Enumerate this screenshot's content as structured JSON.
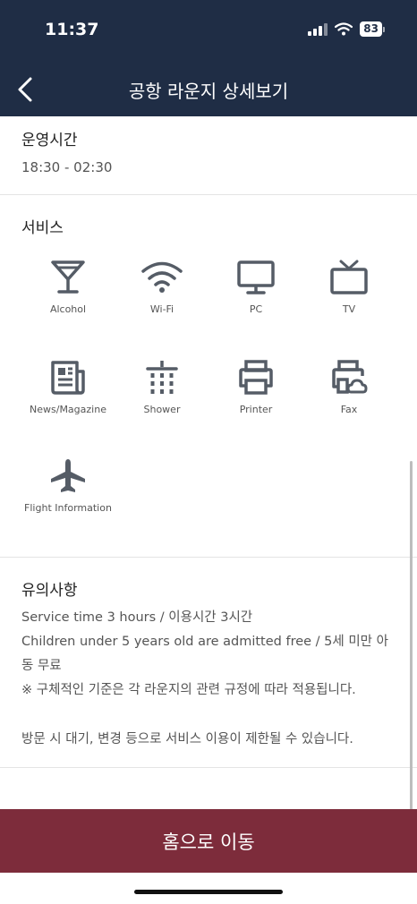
{
  "status_bar": {
    "time": "11:37",
    "battery": "83"
  },
  "header": {
    "title": "공항 라운지 상세보기"
  },
  "hours": {
    "title": "운영시간",
    "value": "18:30 - 02:30"
  },
  "services": {
    "title": "서비스",
    "items": [
      {
        "label": "Alcohol",
        "icon": "cocktail-icon"
      },
      {
        "label": "Wi-Fi",
        "icon": "wifi-icon"
      },
      {
        "label": "PC",
        "icon": "monitor-icon"
      },
      {
        "label": "TV",
        "icon": "tv-icon"
      },
      {
        "label": "News/Magazine",
        "icon": "newspaper-icon"
      },
      {
        "label": "Shower",
        "icon": "shower-icon"
      },
      {
        "label": "Printer",
        "icon": "printer-icon"
      },
      {
        "label": "Fax",
        "icon": "fax-icon"
      },
      {
        "label": "Flight Information",
        "icon": "airplane-icon"
      }
    ]
  },
  "notes": {
    "title": "유의사항",
    "lines": [
      "Service time 3 hours / 이용시간 3시간",
      "Children under 5 years old are admitted free / 5세 미만 아",
      "동 무료",
      "※ 구체적인 기준은 각 라운지의 관련 규정에 따라 적용됩니다.",
      "방문 시 대기, 변경 등으로 서비스 이용이 제한될 수 있습니다."
    ]
  },
  "footer": {
    "button_label": "홈으로 이동"
  },
  "colors": {
    "header_bg": "#1f2d45",
    "button_bg": "#7d2c3b",
    "icon": "#555c66"
  }
}
